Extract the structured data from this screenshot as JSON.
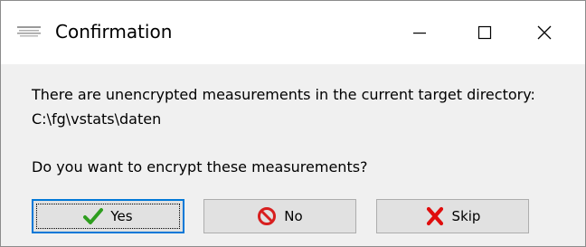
{
  "window": {
    "title": "Confirmation",
    "app_icon": "app-logo-icon"
  },
  "titlebar_buttons": {
    "minimize_icon": "minimize-icon",
    "maximize_icon": "maximize-icon",
    "close_icon": "close-icon"
  },
  "message": {
    "line1": "There are unencrypted measurements in the current target directory:",
    "line2": "C:\\fg\\vstats\\daten",
    "question": "Do you want to encrypt these measurements?"
  },
  "buttons": {
    "yes": {
      "label": "Yes",
      "icon": "checkmark-icon",
      "icon_color": "#2e9e1f"
    },
    "no": {
      "label": "No",
      "icon": "prohibited-icon",
      "icon_color": "#d81f1f"
    },
    "skip": {
      "label": "Skip",
      "icon": "x-mark-icon",
      "icon_color": "#e00d0d"
    }
  },
  "colors": {
    "titlebar_bg": "#ffffff",
    "body_bg": "#f0f0f0",
    "button_bg": "#e1e1e1",
    "default_button_border": "#0078d7"
  }
}
